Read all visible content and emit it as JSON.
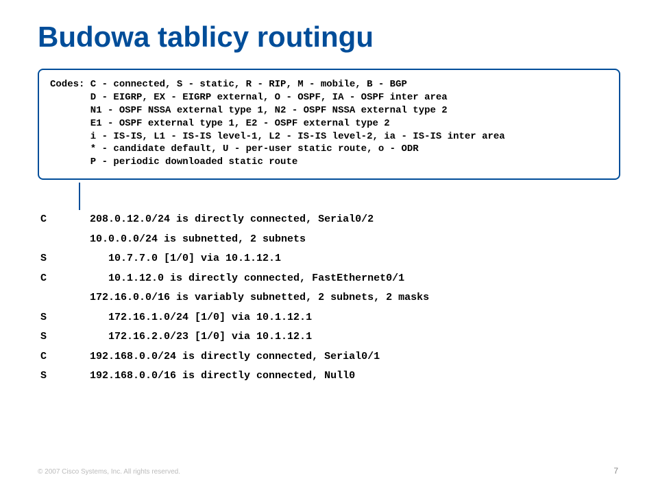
{
  "title": "Budowa tablicy routingu",
  "codes": {
    "l1": "Codes: C - connected, S - static, R - RIP, M - mobile, B - BGP",
    "l2": "       D - EIGRP, EX - EIGRP external, O - OSPF, IA - OSPF inter area",
    "l3": "       N1 - OSPF NSSA external type 1, N2 - OSPF NSSA external type 2",
    "l4": "       E1 - OSPF external type 1, E2 - OSPF external type 2",
    "l5": "       i - IS-IS, L1 - IS-IS level-1, L2 - IS-IS level-2, ia - IS-IS inter area",
    "l6": "       * - candidate default, U - per-user static route, o - ODR",
    "l7": "       P - periodic downloaded static route"
  },
  "routes": {
    "r1": "C       208.0.12.0/24 is directly connected, Serial0/2",
    "r2": "        10.0.0.0/24 is subnetted, 2 subnets",
    "r3": "S          10.7.7.0 [1/0] via 10.1.12.1",
    "r4": "C          10.1.12.0 is directly connected, FastEthernet0/1",
    "r5": "        172.16.0.0/16 is variably subnetted, 2 subnets, 2 masks",
    "r6": "S          172.16.1.0/24 [1/0] via 10.1.12.1",
    "r7": "S          172.16.2.0/23 [1/0] via 10.1.12.1",
    "r8": "C       192.168.0.0/24 is directly connected, Serial0/1",
    "r9": "S       192.168.0.0/16 is directly connected, Null0"
  },
  "footer": "© 2007 Cisco Systems, Inc. All rights reserved.",
  "pagenum": "7"
}
